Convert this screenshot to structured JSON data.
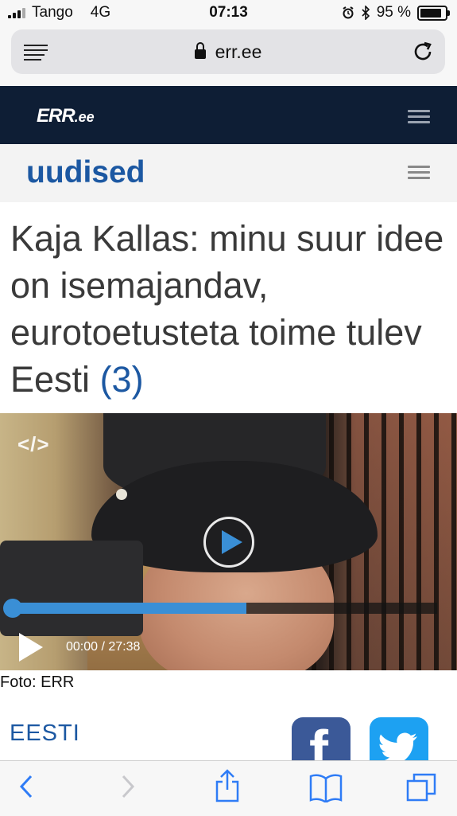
{
  "status_bar": {
    "carrier": "Tango",
    "network": "4G",
    "time": "07:13",
    "battery": "95 %",
    "battery_level": 0.95,
    "icons": [
      "signal-icon",
      "alarm-icon",
      "bluetooth-icon",
      "battery-icon"
    ]
  },
  "browser": {
    "url": "err.ee",
    "icons": [
      "reader-icon",
      "lock-icon",
      "reload-icon"
    ]
  },
  "site": {
    "logo": "ERR",
    "logo_suffix": ".ee",
    "section_title": "uudised"
  },
  "article": {
    "headline": "Kaja Kallas: minu suur idee on isemajandav, eurotoetusteta toime tulev Eesti",
    "comment_count": "(3)",
    "video": {
      "embed_label": "</>",
      "timecode": "00:00 / 27:38",
      "progress_fraction": 0.55
    },
    "photo_credit": "Foto: ERR",
    "category": "EESTI",
    "share": [
      "facebook-icon",
      "twitter-icon"
    ]
  },
  "colors": {
    "brand_dark": "#0e1e35",
    "accent_blue": "#1c58a2",
    "player_blue": "#3a8fd6",
    "facebook": "#3b5998",
    "twitter": "#1da1f2"
  },
  "toolbar": {
    "icons": [
      "back-icon",
      "forward-icon",
      "share-icon",
      "bookmarks-icon",
      "tabs-icon"
    ]
  }
}
